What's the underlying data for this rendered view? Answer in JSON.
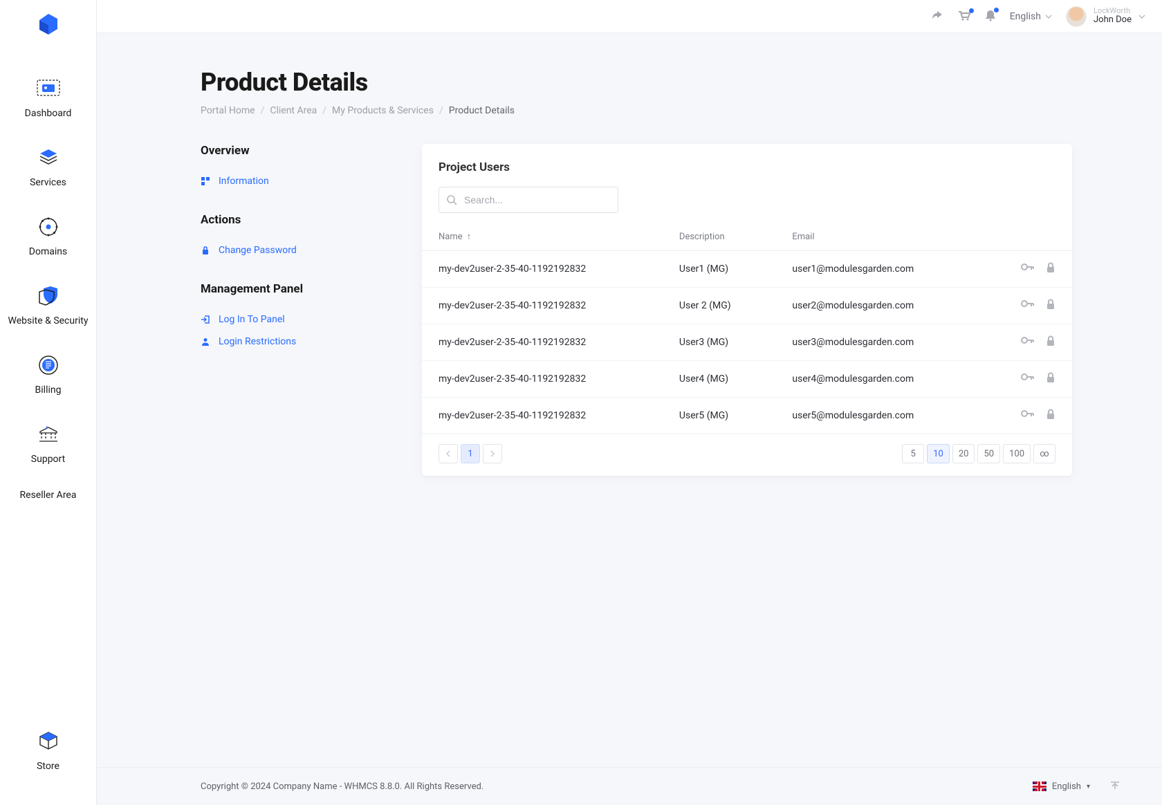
{
  "brand": "LockWorth",
  "header": {
    "language": "English",
    "user_company": "LockWorth",
    "user_name": "John Doe"
  },
  "sidebar": {
    "items": [
      {
        "label": "Dashboard"
      },
      {
        "label": "Services"
      },
      {
        "label": "Domains"
      },
      {
        "label": "Website & Security"
      },
      {
        "label": "Billing"
      },
      {
        "label": "Support"
      },
      {
        "label": "Reseller Area"
      }
    ],
    "bottom": {
      "label": "Store"
    }
  },
  "page": {
    "title": "Product Details",
    "breadcrumb": [
      "Portal Home",
      "Client Area",
      "My Products & Services",
      "Product Details"
    ]
  },
  "side_panel": {
    "sections": [
      {
        "title": "Overview",
        "links": [
          {
            "label": "Information",
            "icon": "info"
          }
        ]
      },
      {
        "title": "Actions",
        "links": [
          {
            "label": "Change Password",
            "icon": "lock"
          }
        ]
      },
      {
        "title": "Management Panel",
        "links": [
          {
            "label": "Log In To Panel",
            "icon": "login"
          },
          {
            "label": "Login Restrictions",
            "icon": "user"
          }
        ]
      }
    ]
  },
  "card": {
    "title": "Project Users",
    "search_placeholder": "Search...",
    "columns": [
      "Name",
      "Description",
      "Email"
    ],
    "rows": [
      {
        "name": "my-dev2user-2-35-40-1192192832",
        "desc": "User1 (MG)",
        "email": "user1@modulesgarden.com"
      },
      {
        "name": "my-dev2user-2-35-40-1192192832",
        "desc": "User 2 (MG)",
        "email": "user2@modulesgarden.com"
      },
      {
        "name": "my-dev2user-2-35-40-1192192832",
        "desc": "User3 (MG)",
        "email": "user3@modulesgarden.com"
      },
      {
        "name": "my-dev2user-2-35-40-1192192832",
        "desc": "User4 (MG)",
        "email": "user4@modulesgarden.com"
      },
      {
        "name": "my-dev2user-2-35-40-1192192832",
        "desc": "User5 (MG)",
        "email": "user5@modulesgarden.com"
      }
    ],
    "pagination": {
      "pages": [
        "1"
      ],
      "active_page": "1"
    },
    "page_sizes": [
      "5",
      "10",
      "20",
      "50",
      "100",
      "∞"
    ],
    "active_page_size": "10"
  },
  "footer": {
    "copyright": "Copyright © 2024 Company Name - WHMCS 8.8.0. All Rights Reserved.",
    "language": "English"
  }
}
